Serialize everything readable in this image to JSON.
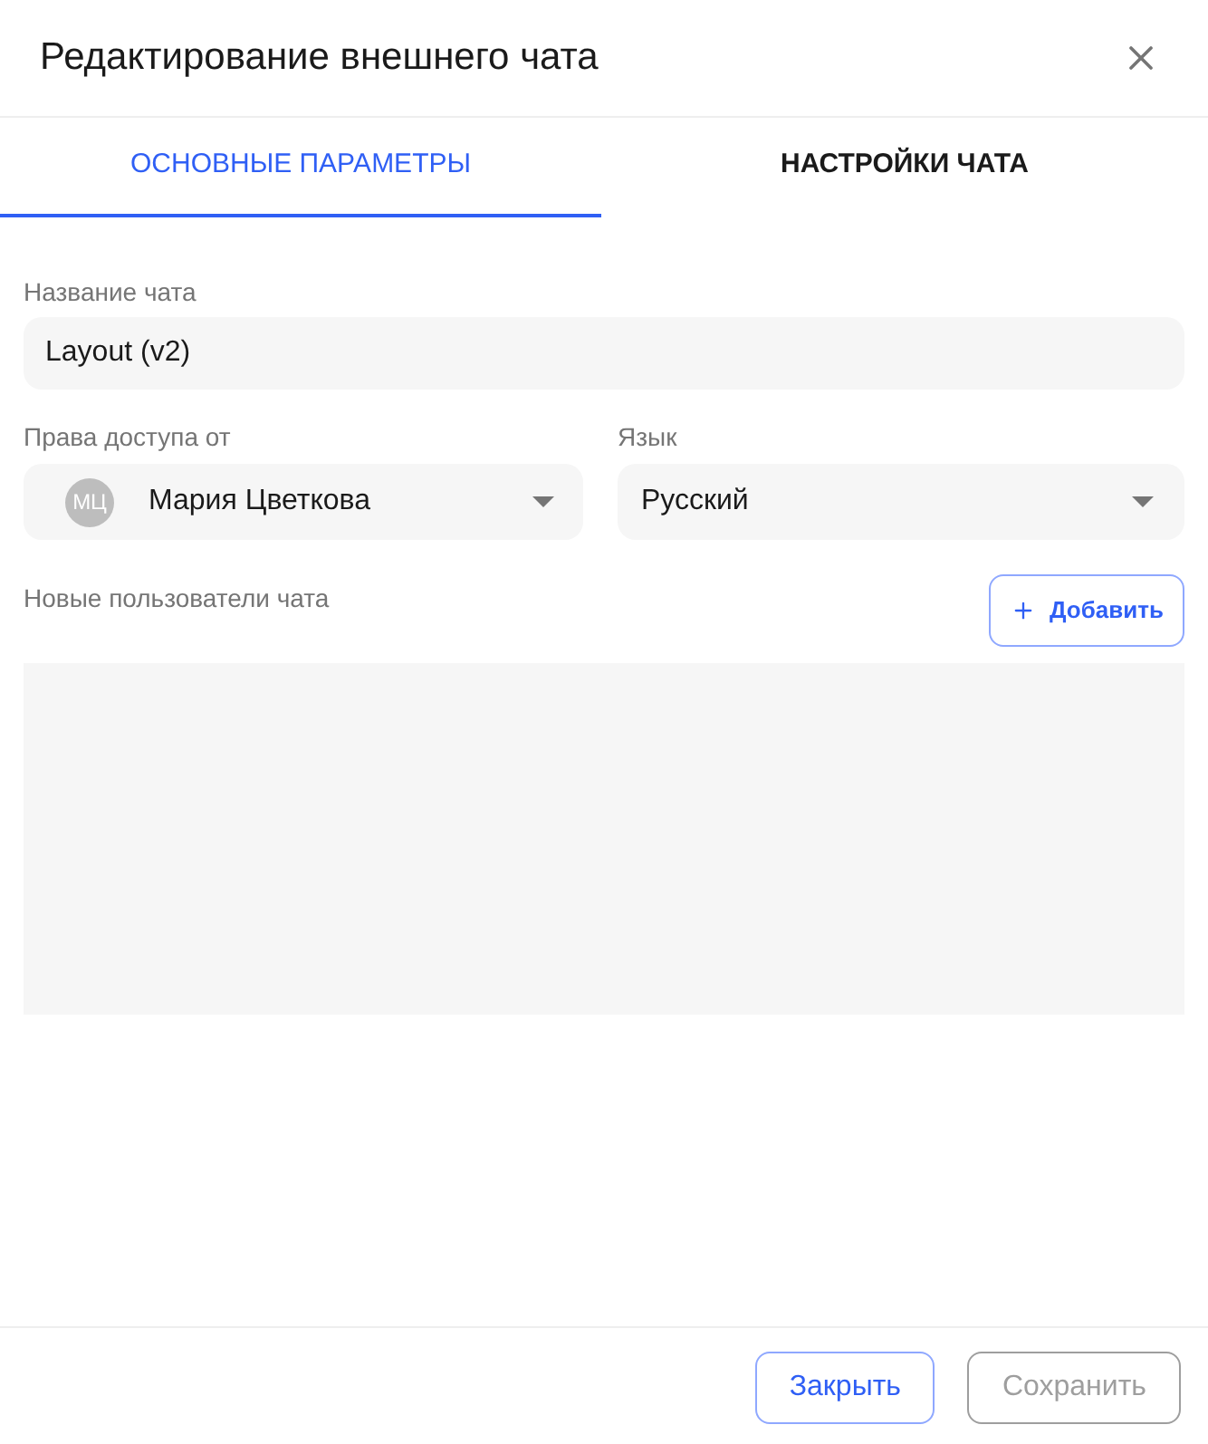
{
  "dialog": {
    "title": "Редактирование внешнего чата"
  },
  "tabs": [
    {
      "label": "ОСНОВНЫЕ ПАРАМЕТРЫ",
      "selected": true
    },
    {
      "label": "НАСТРОЙКИ ЧАТА",
      "selected": false
    }
  ],
  "fields": {
    "chat_name": {
      "label": "Название чата",
      "value": "Layout (v2)"
    },
    "access_from": {
      "label": "Права доступа от",
      "avatar_initials": "МЦ",
      "value": "Мария Цветкова"
    },
    "language": {
      "label": "Язык",
      "value": "Русский"
    }
  },
  "new_users": {
    "label": "Новые пользователи чата",
    "add_button": "Добавить"
  },
  "footer": {
    "buttons": [
      {
        "label": "Закрыть",
        "disabled": false
      },
      {
        "label": "Сохранить",
        "disabled": true
      }
    ]
  }
}
